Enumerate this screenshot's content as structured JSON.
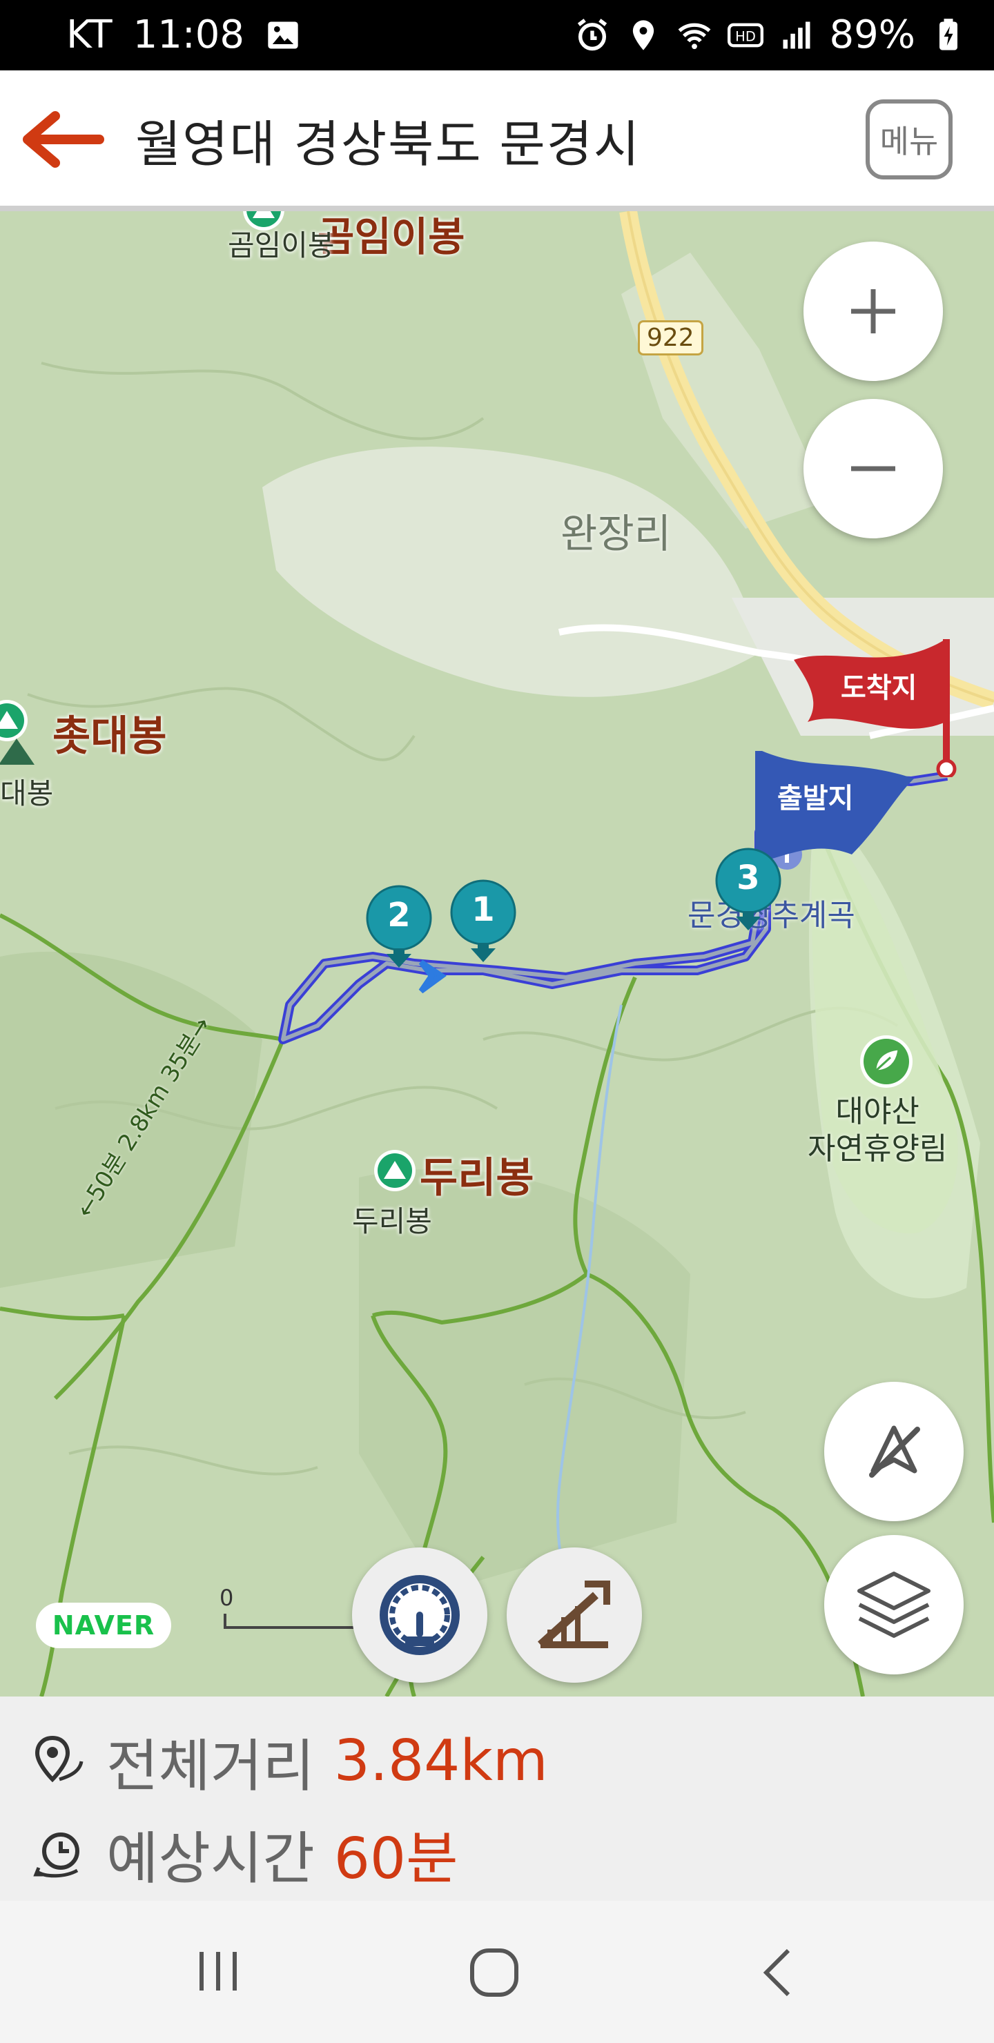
{
  "status_bar": {
    "carrier": "KT",
    "time": "11:08",
    "battery": "89%"
  },
  "header": {
    "title": "월영대 경상북도 문경시",
    "menu_label": "메뉴"
  },
  "map": {
    "road_number": "922",
    "labels": {
      "top_peak": "곰임이봉",
      "top_peak_small": "곰임이봉",
      "village": "완장리",
      "left_peak": "촛대봉",
      "left_peak_small": "대봉",
      "peak_duri": "두리봉",
      "peak_duri_small": "두리봉",
      "valley": "문경쌍추계곡",
      "forest": "대야산\n자연휴양림",
      "trail": "←50분 2.8km 35분→"
    },
    "flags": {
      "arrival": "도착지",
      "departure": "출발지"
    },
    "waypoints": [
      "1",
      "2",
      "3"
    ],
    "scale_zero": "0",
    "brand": "NAVER"
  },
  "summary": {
    "distance_label": "전체거리",
    "distance_value": "3.84km",
    "time_label": "예상시간",
    "time_value": "60분"
  },
  "colors": {
    "accent": "#d03a12",
    "route": "#3a3fd6",
    "arrival_flag": "#c8282d",
    "departure_flag": "#3458b5",
    "waypoint": "#1a98a8",
    "naver": "#19c14b"
  },
  "icons": [
    "back-arrow-icon",
    "zoom-in-icon",
    "zoom-out-icon",
    "compass-off-icon",
    "layers-icon",
    "speedometer-icon",
    "slope-icon",
    "distance-icon",
    "time-icon"
  ]
}
